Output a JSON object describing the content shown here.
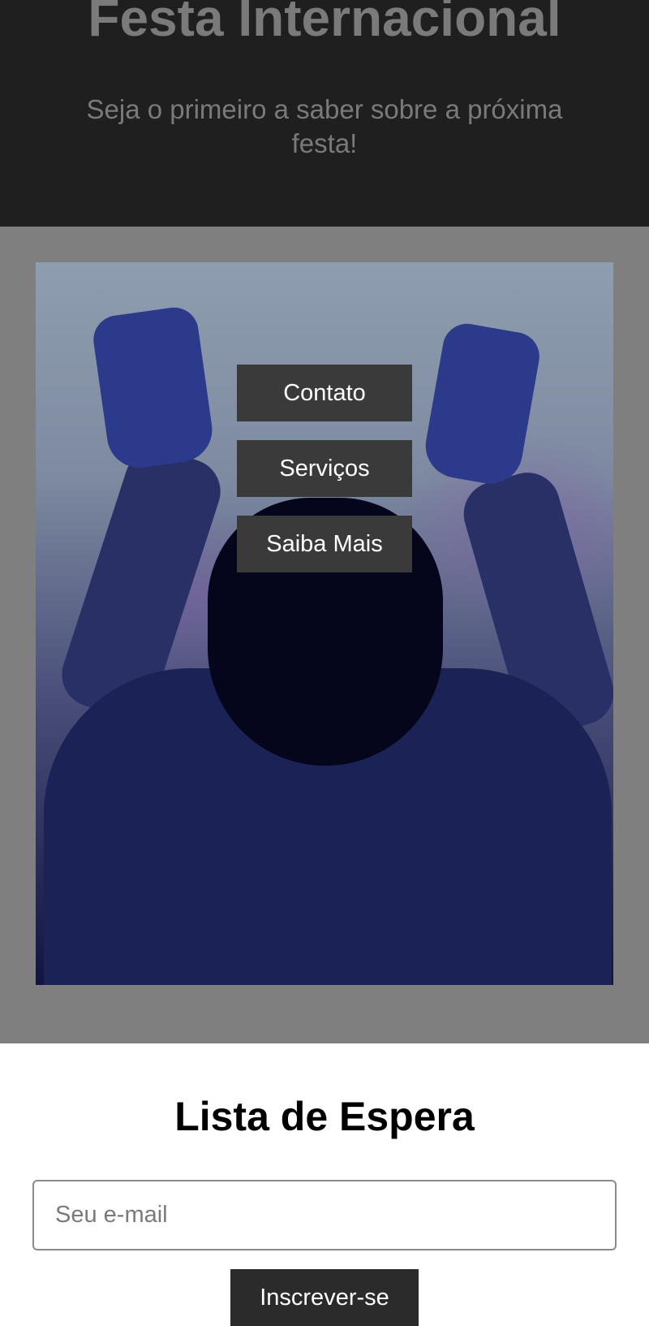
{
  "header": {
    "title": "Festa Internacional",
    "subtitle": "Seja o primeiro a saber sobre a próxima festa!"
  },
  "hero": {
    "nav": [
      {
        "label": "Contato"
      },
      {
        "label": "Serviços"
      },
      {
        "label": "Saiba Mais"
      }
    ]
  },
  "waitlist": {
    "title": "Lista de Espera",
    "email_placeholder": "Seu e-mail",
    "submit_label": "Inscrever-se"
  },
  "colors": {
    "header_bg": "#1f1f1f",
    "hero_bg": "#7f7f7f",
    "button_bg": "#3a3a3a",
    "muted_text": "#7a7a7a"
  }
}
